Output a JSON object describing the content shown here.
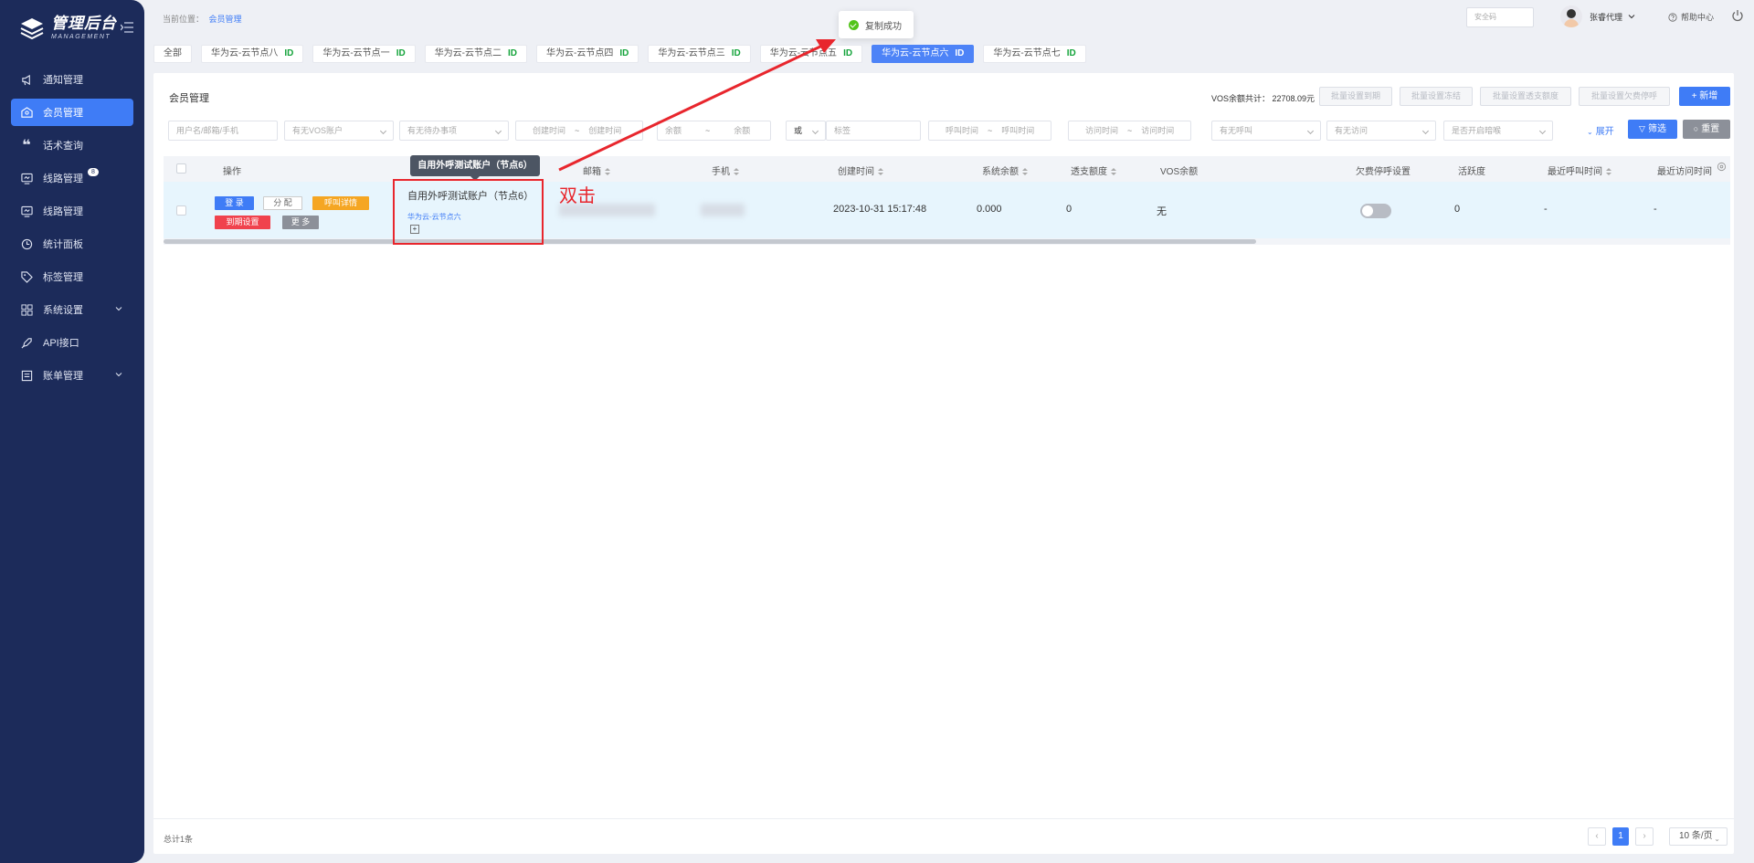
{
  "sidebar": {
    "logo_title": "管理后台",
    "logo_sub": "MANAGEMENT",
    "items": [
      {
        "label": "通知管理",
        "icon": "megaphone-icon",
        "active": false
      },
      {
        "label": "会员管理",
        "icon": "member-icon",
        "active": true
      },
      {
        "label": "话术查询",
        "icon": "quote-icon",
        "active": false
      },
      {
        "label": "线路管理",
        "icon": "monitor-icon",
        "active": false,
        "badge": "8"
      },
      {
        "label": "线路管理",
        "icon": "monitor-icon",
        "active": false
      },
      {
        "label": "统计面板",
        "icon": "clock-icon",
        "active": false
      },
      {
        "label": "标签管理",
        "icon": "tag-icon",
        "active": false
      },
      {
        "label": "系统设置",
        "icon": "grid-icon",
        "active": false,
        "expandable": true
      },
      {
        "label": "API接口",
        "icon": "rocket-icon",
        "active": false
      },
      {
        "label": "账单管理",
        "icon": "bill-icon",
        "active": false,
        "expandable": true
      }
    ],
    "accent_color": "#3f7cf6",
    "bg_color": "#1c2b5a"
  },
  "topbar": {
    "breadcrumb_prefix": "当前位置：",
    "breadcrumb_current": "会员管理",
    "toast": "复制成功",
    "safe_code_placeholder": "安全码",
    "username": "张睿代理",
    "help": "帮助中心"
  },
  "tags": [
    {
      "label": "全部",
      "id": "",
      "active": false
    },
    {
      "label": "华为云-云节点八",
      "id": "ID",
      "active": false
    },
    {
      "label": "华为云-云节点一",
      "id": "ID",
      "active": false
    },
    {
      "label": "华为云-云节点二",
      "id": "ID",
      "active": false
    },
    {
      "label": "华为云-云节点四",
      "id": "ID",
      "active": false
    },
    {
      "label": "华为云-云节点三",
      "id": "ID",
      "active": false
    },
    {
      "label": "华为云-云节点五",
      "id": "ID",
      "active": false
    },
    {
      "label": "华为云-云节点六",
      "id": "ID",
      "active": true
    },
    {
      "label": "华为云-云节点七",
      "id": "ID",
      "active": false
    }
  ],
  "card": {
    "title": "会员管理",
    "vos_total": "VOS余额共计：  22708.09元",
    "batch_buttons": [
      "批量设置到期",
      "批量设置冻结",
      "批量设置透支额度",
      "批量设置欠费停呼"
    ],
    "add_button": "+ 新增",
    "filter_button": "筛选",
    "reset_button": "重置",
    "expand": "展开"
  },
  "filters": {
    "user": "用户名/邮箱/手机",
    "vos": "有无VOS账户",
    "todo": "有无待办事项",
    "created_start": "创建时间",
    "created_end": "创建时间",
    "balance_min": "余额",
    "balance_max": "余额",
    "tilde": "~",
    "or": "或",
    "tag": "标签",
    "call_start": "呼叫时间",
    "call_end": "呼叫时间",
    "visit_start": "访问时间",
    "visit_end": "访问时间",
    "has_call": "有无呼叫",
    "has_visit": "有无访问",
    "dark_mode": "是否开启暗喉"
  },
  "table": {
    "headers": {
      "op": "操作",
      "email": "邮箱",
      "phone": "手机",
      "created": "创建时间",
      "sys_balance": "系统余额",
      "overdraft": "透支额度",
      "vos_balance": "VOS余额",
      "arrears_stop": "欠费停呼设置",
      "activity": "活跃度",
      "last_call": "最近呼叫时间",
      "last_visit": "最近访问时间"
    },
    "row": {
      "buttons": {
        "login": "登 录",
        "assign": "分 配",
        "call_detail": "呼叫详情",
        "expire": "到期设置",
        "more": "更 多"
      },
      "name": "自用外呼测试账户（节点6）",
      "node": "华为云-云节点六",
      "created": "2023-10-31 15:17:48",
      "sys_balance": "0.000",
      "overdraft": "0",
      "vos_balance": "无",
      "arrears_stop_on": false,
      "activity": "0",
      "last_call": "-",
      "last_visit": "-"
    }
  },
  "tooltip": "自用外呼测试账户（节点6）",
  "annotation": "双击",
  "footer": {
    "total": "总计1条",
    "page": "1",
    "page_size": "10 条/页"
  }
}
